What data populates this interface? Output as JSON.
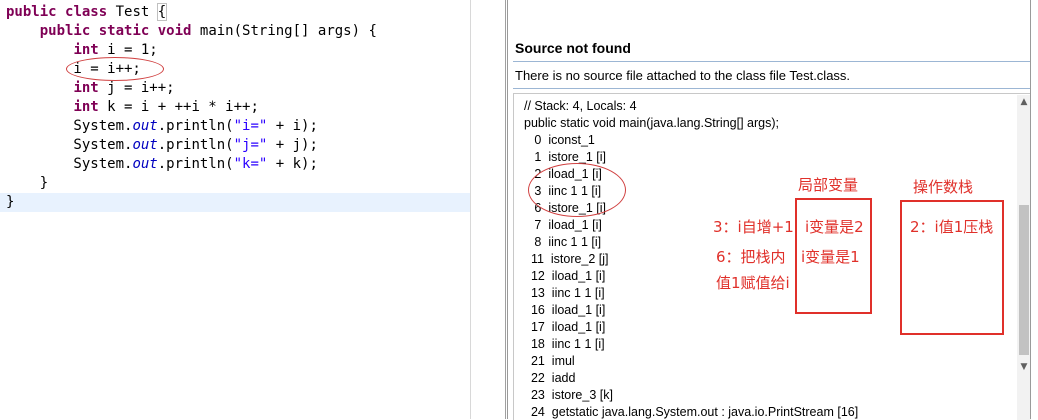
{
  "editor": {
    "lines": [
      {
        "parts": [
          {
            "t": "public",
            "c": "kw"
          },
          {
            "t": " "
          },
          {
            "t": "class",
            "c": "kw"
          },
          {
            "t": " Test "
          },
          {
            "t": "{",
            "c": "brk"
          }
        ]
      },
      {
        "parts": [
          {
            "t": "    "
          },
          {
            "t": "public",
            "c": "kw"
          },
          {
            "t": " "
          },
          {
            "t": "static",
            "c": "kw"
          },
          {
            "t": " "
          },
          {
            "t": "void",
            "c": "kw"
          },
          {
            "t": " main(String[] args) {"
          }
        ]
      },
      {
        "parts": [
          {
            "t": "        "
          },
          {
            "t": "int",
            "c": "kw"
          },
          {
            "t": " i = 1;"
          }
        ]
      },
      {
        "parts": [
          {
            "t": "        i = i++;"
          }
        ]
      },
      {
        "parts": [
          {
            "t": "        "
          },
          {
            "t": "int",
            "c": "kw"
          },
          {
            "t": " j = i++;"
          }
        ]
      },
      {
        "parts": [
          {
            "t": "        "
          },
          {
            "t": "int",
            "c": "kw"
          },
          {
            "t": " k = i + ++i * i++;"
          }
        ]
      },
      {
        "parts": [
          {
            "t": "        System."
          },
          {
            "t": "out",
            "c": "fld"
          },
          {
            "t": ".println("
          },
          {
            "t": "\"i=\"",
            "c": "str"
          },
          {
            "t": " + i);"
          }
        ]
      },
      {
        "parts": [
          {
            "t": "        System."
          },
          {
            "t": "out",
            "c": "fld"
          },
          {
            "t": ".println("
          },
          {
            "t": "\"j=\"",
            "c": "str"
          },
          {
            "t": " + j);"
          }
        ]
      },
      {
        "parts": [
          {
            "t": "        System."
          },
          {
            "t": "out",
            "c": "fld"
          },
          {
            "t": ".println("
          },
          {
            "t": "\"k=\"",
            "c": "str"
          },
          {
            "t": " + k);"
          }
        ]
      },
      {
        "parts": [
          {
            "t": "    }"
          }
        ]
      },
      {
        "parts": [
          {
            "t": "}"
          }
        ],
        "current": true
      }
    ]
  },
  "viewer": {
    "title": "Source not found",
    "message": "There is no source file attached to the class file Test.class.",
    "bytecode": [
      "// Stack: 4, Locals: 4",
      "public static void main(java.lang.String[] args);",
      "   0  iconst_1",
      "   1  istore_1 [i]",
      "   2  iload_1 [i]",
      "   3  iinc 1 1 [i]",
      "   6  istore_1 [i]",
      "   7  iload_1 [i]",
      "   8  iinc 1 1 [i]",
      "  11  istore_2 [j]",
      "  12  iload_1 [i]",
      "  13  iinc 1 1 [i]",
      "  16  iload_1 [i]",
      "  17  iload_1 [i]",
      "  18  iinc 1 1 [i]",
      "  21  imul",
      "  22  iadd",
      "  23  istore_3 [k]",
      "  24  getstatic java.lang.System.out : java.io.PrintStream [16]"
    ]
  },
  "annotations": {
    "local_vars_title": "局部变量",
    "operand_stack_title": "操作数栈",
    "step3": "3：i自增+1",
    "local_i_2": "i变量是2",
    "stack_val": "2：i值1压栈",
    "step6_a": "6：把栈内",
    "local_i_1": "i变量是1",
    "step6_b": "值1赋值给i",
    "color": "#e0302a"
  }
}
